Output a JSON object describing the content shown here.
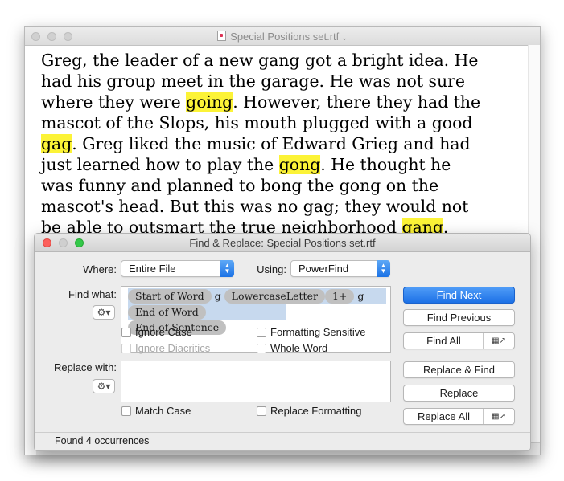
{
  "document_window": {
    "title": "Special Positions set.rtf",
    "lines": [
      [
        {
          "text": "Greg, the leader of a new gang got a bright idea. He"
        }
      ],
      [
        {
          "text": "had his group meet in the garage. He was not sure"
        }
      ],
      [
        {
          "text": "where they were "
        },
        {
          "text": "going",
          "highlight": true
        },
        {
          "text": ". However, there they had the"
        }
      ],
      [
        {
          "text": "mascot of the Slops, his mouth plugged with a good"
        }
      ],
      [
        {
          "text": "gag",
          "highlight": true
        },
        {
          "text": ". Greg liked the music of Edward Grieg and had"
        }
      ],
      [
        {
          "text": "just learned how to play the "
        },
        {
          "text": "gong",
          "highlight": true
        },
        {
          "text": ". He thought he"
        }
      ],
      [
        {
          "text": "was funny and planned to bong the gong on the"
        }
      ],
      [
        {
          "text": "mascot's head. But this was no gag; they would not"
        }
      ],
      [
        {
          "text": "be able to outsmart the true neighborhood "
        },
        {
          "text": "gang",
          "highlight": true
        },
        {
          "text": "."
        }
      ]
    ],
    "highlight_color": "#fcf337"
  },
  "find_replace": {
    "title": "Find & Replace: Special Positions set.rtf",
    "where_label": "Where:",
    "where_value": "Entire File",
    "using_label": "Using:",
    "using_value": "PowerFind",
    "find_label": "Find what:",
    "find_row1": [
      {
        "type": "token",
        "text": "Start of Word"
      },
      {
        "type": "text",
        "text": "g"
      },
      {
        "type": "token",
        "text": "LowercaseLetter"
      },
      {
        "type": "token",
        "text": "1+"
      },
      {
        "type": "text",
        "text": "g"
      }
    ],
    "find_row2": [
      {
        "type": "token",
        "text": "End of Word"
      },
      {
        "type": "token",
        "text": "End of Sentence"
      }
    ],
    "replace_label": "Replace with:",
    "options": {
      "ignore_case": "Ignore Case",
      "formatting_sensitive": "Formatting Sensitive",
      "ignore_diacritics": "Ignore Diacritics",
      "whole_word": "Whole Word",
      "match_case": "Match Case",
      "replace_formatting": "Replace Formatting"
    },
    "buttons": {
      "find_next": "Find Next",
      "find_previous": "Find Previous",
      "find_all": "Find All",
      "replace_and_find": "Replace & Find",
      "replace": "Replace",
      "replace_all": "Replace All"
    },
    "status": "Found 4 occurrences",
    "accent_color": "#1c70e6"
  }
}
